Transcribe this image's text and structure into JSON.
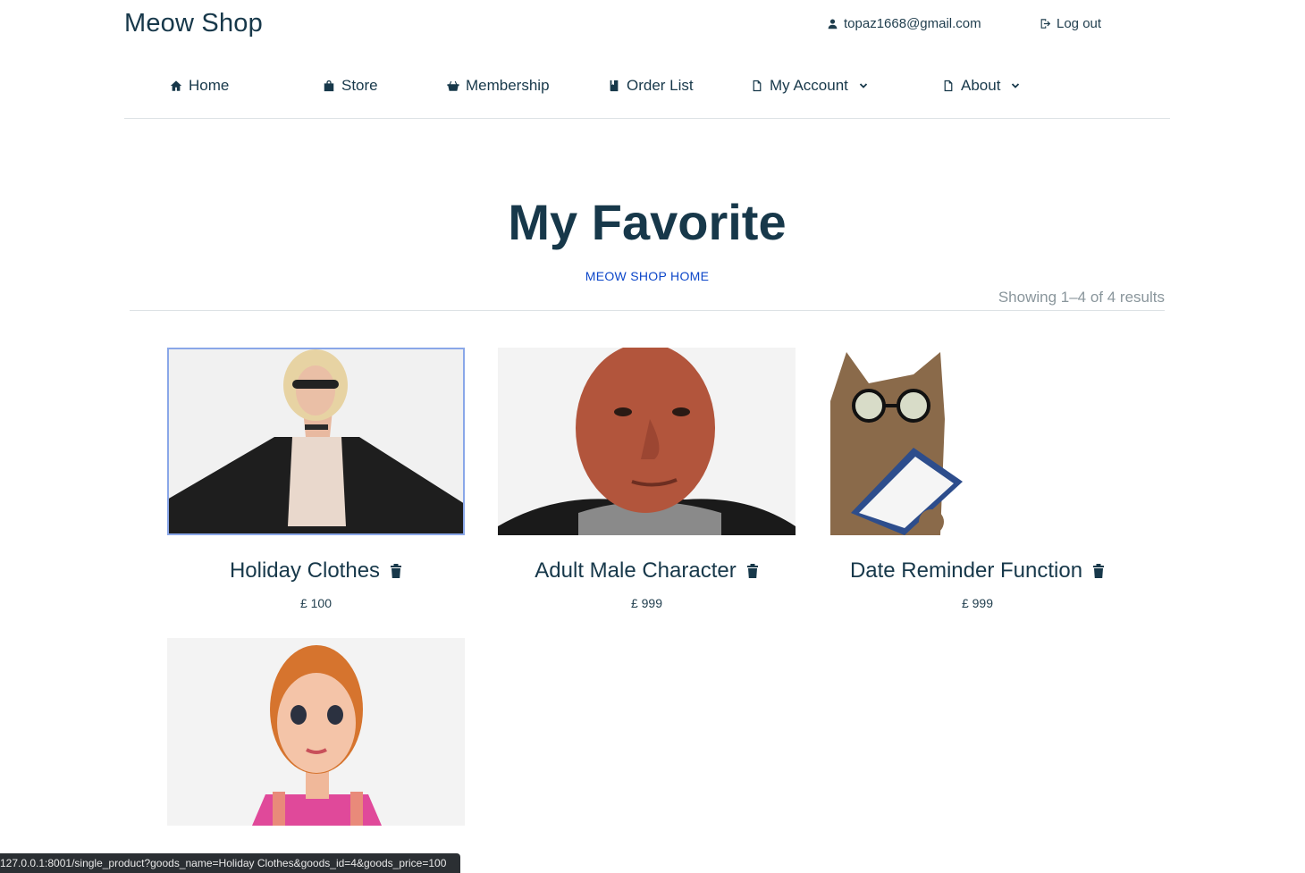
{
  "header": {
    "brand": "Meow Shop",
    "user_email": "topaz1668@gmail.com",
    "logout_label": "Log out"
  },
  "nav": {
    "home": "Home",
    "store": "Store",
    "membership": "Membership",
    "order_list": "Order List",
    "my_account": "My Account",
    "about": "About"
  },
  "page": {
    "title": "My Favorite",
    "breadcrumb": "MEOW SHOP HOME",
    "results": "Showing 1–4 of 4 results"
  },
  "products": [
    {
      "name": "Holiday Clothes",
      "price": "£ 100",
      "image": "woman-jacket-3d"
    },
    {
      "name": "Adult Male Character",
      "price": "£ 999",
      "image": "bald-man-3d"
    },
    {
      "name": "Date Reminder Function",
      "price": "£ 999",
      "image": "cat-with-glasses-clipboard"
    },
    {
      "name": "",
      "price": "",
      "image": "redhead-girl-3d"
    }
  ],
  "status_bar": {
    "url": "127.0.0.1:8001/single_product?goods_name=Holiday Clothes&goods_id=4&goods_price=100"
  },
  "colors": {
    "text": "#17384a",
    "link": "#0d47c9",
    "muted": "#8a969c",
    "rule": "#dde2e5"
  },
  "icons": {
    "user": "user-icon",
    "logout": "logout-icon",
    "home": "home-icon",
    "store": "bag-icon",
    "membership": "basket-icon",
    "order_list": "book-icon",
    "account": "file-icon",
    "about": "file-icon",
    "chevron": "chevron-down-icon",
    "delete": "trash-icon"
  }
}
